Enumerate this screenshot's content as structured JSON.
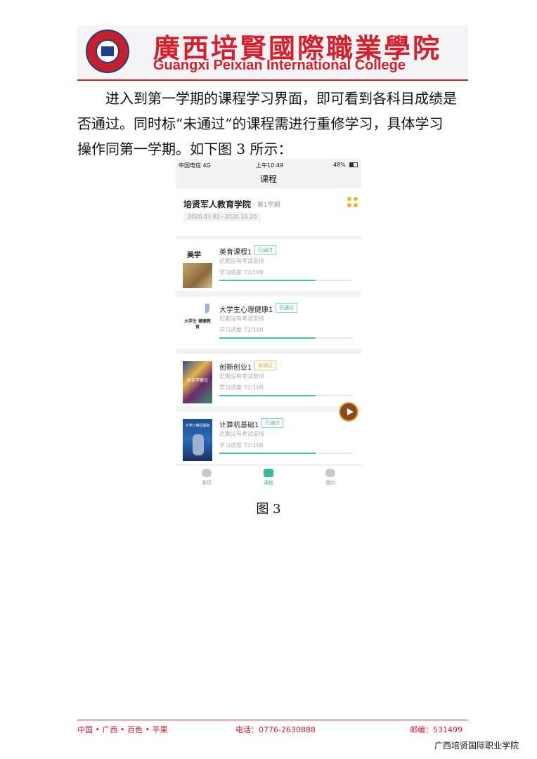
{
  "header": {
    "college_cn": "廣西培賢國際職業學院",
    "college_en": "Guangxi Peixian International College"
  },
  "body": {
    "line1": "进入到第一学期的课程学习界面，即可看到各科目成绩是",
    "line2": "否通过。同时标“未通过”的课程需进行重修学习，具体学习",
    "line3": "操作同第一学期。如下图 3 所示："
  },
  "phone": {
    "status": {
      "carrier": "中国电信 4G",
      "time": "上午10:49",
      "battery": "48%"
    },
    "nav_title": "课程",
    "semester": {
      "name": "培贤军人教育学院",
      "term": "· 第1学期",
      "dates": "2020.03.02~2020.10.20",
      "menu_icon": "dots-grid-icon"
    },
    "courses": [
      {
        "name": "美育课程1",
        "status": "已通过",
        "passed": true,
        "exam": "近期没有考试安排",
        "progress_label": "学习进度 72/100",
        "progress": 0.72,
        "thumb_text": "美学"
      },
      {
        "name": "大学生心理健康1",
        "status": "已通过",
        "passed": true,
        "exam": "近期没有考试安排",
        "progress_label": "学习进度 72/100",
        "progress": 0.72,
        "thumb_text": "大学生 健康教育"
      },
      {
        "name": "创新创业1",
        "status": "未通过",
        "passed": false,
        "exam": "近期没有考试安排",
        "progress_label": "学习进度 72/100",
        "progress": 0.72,
        "thumb_text": "创业学概论"
      },
      {
        "name": "计算机基础1",
        "status": "已通过",
        "passed": true,
        "exam": "近期没有考试安排",
        "progress_label": "学习进度 72/100",
        "progress": 0.72,
        "thumb_text": "大学计算机基础"
      }
    ],
    "tabs": [
      {
        "label": "发现",
        "icon": "planet-icon",
        "active": false
      },
      {
        "label": "课程",
        "icon": "tv-icon",
        "active": true
      },
      {
        "label": "我的",
        "icon": "user-icon",
        "active": false
      }
    ]
  },
  "caption": "图 3",
  "footer": {
    "location": "中国 • 广西 • 百色 • 平果",
    "phone": "电话：0776-2630888",
    "postcode": "邮编：531499",
    "org": "广西培贤国际职业学院"
  },
  "colors": {
    "brand_red": "#d3202c",
    "accent_green": "#3fb59a",
    "warning_orange": "#e7a033"
  }
}
